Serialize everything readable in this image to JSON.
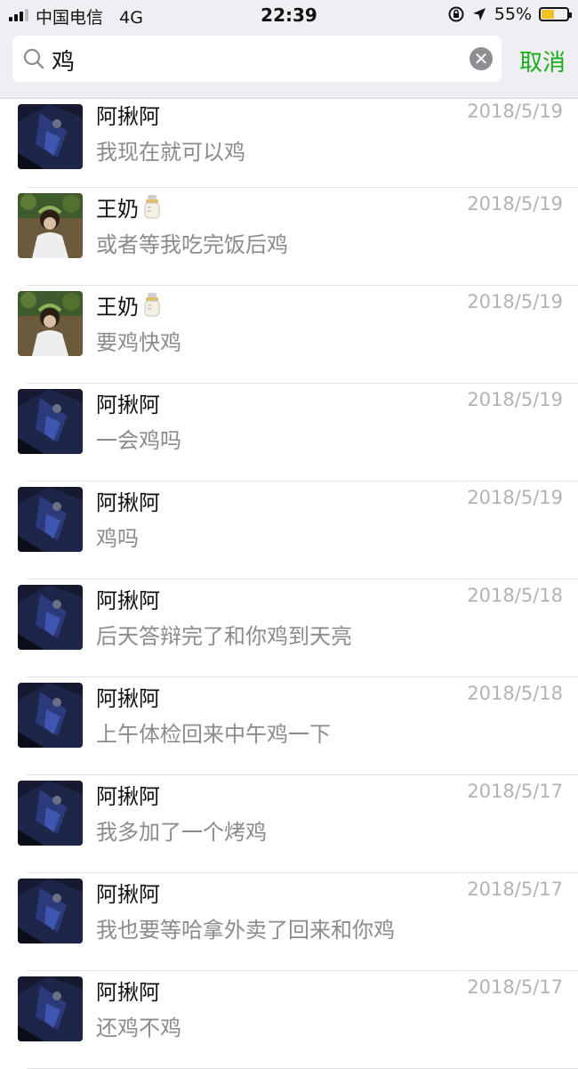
{
  "status_bar": {
    "carrier": "中国电信",
    "network": "4G",
    "time": "22:39",
    "battery": "55%",
    "battery_level": 0.55,
    "icons": [
      "signal-icon",
      "rotation-lock-icon",
      "location-arrow-icon",
      "battery-icon"
    ]
  },
  "search": {
    "query": "鸡",
    "cancel_label": "取消",
    "accent_color": "#1aad19"
  },
  "results": [
    {
      "name": "阿揪阿",
      "message": "我现在就可以鸡",
      "date": "2018/5/19",
      "avatar": "dark"
    },
    {
      "name": "王奶",
      "emoji": "baby-bottle",
      "message": "或者等我吃完饭后鸡",
      "date": "2018/5/19",
      "avatar": "portrait"
    },
    {
      "name": "王奶",
      "emoji": "baby-bottle",
      "message": "要鸡快鸡",
      "date": "2018/5/19",
      "avatar": "portrait"
    },
    {
      "name": "阿揪阿",
      "message": "一会鸡吗",
      "date": "2018/5/19",
      "avatar": "dark"
    },
    {
      "name": "阿揪阿",
      "message": "鸡吗",
      "date": "2018/5/19",
      "avatar": "dark"
    },
    {
      "name": "阿揪阿",
      "message": "后天答辩完了和你鸡到天亮",
      "date": "2018/5/18",
      "avatar": "dark"
    },
    {
      "name": "阿揪阿",
      "message": "上午体检回来中午鸡一下",
      "date": "2018/5/18",
      "avatar": "dark"
    },
    {
      "name": "阿揪阿",
      "message": "我多加了一个烤鸡",
      "date": "2018/5/17",
      "avatar": "dark"
    },
    {
      "name": "阿揪阿",
      "message": "我也要等哈拿外卖了回来和你鸡",
      "date": "2018/5/17",
      "avatar": "dark"
    },
    {
      "name": "阿揪阿",
      "message": "还鸡不鸡",
      "date": "2018/5/17",
      "avatar": "dark"
    }
  ]
}
